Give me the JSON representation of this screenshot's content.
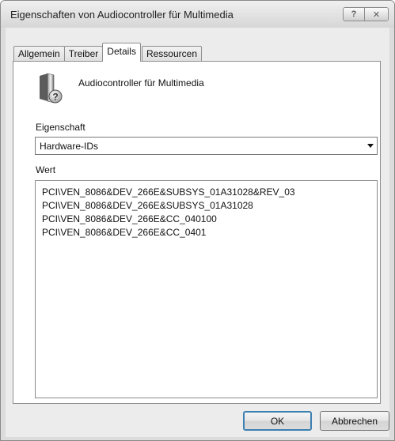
{
  "window": {
    "title": "Eigenschaften von Audiocontroller für Multimedia",
    "help_label": "?",
    "close_label": "✕"
  },
  "tabs": [
    {
      "label": "Allgemein",
      "active": false
    },
    {
      "label": "Treiber",
      "active": false
    },
    {
      "label": "Details",
      "active": true
    },
    {
      "label": "Ressourcen",
      "active": false
    }
  ],
  "device": {
    "name": "Audiocontroller für Multimedia",
    "icon": "speaker-question-icon"
  },
  "property": {
    "label": "Eigenschaft",
    "selected": "Hardware-IDs"
  },
  "value": {
    "label": "Wert",
    "items": [
      "PCI\\VEN_8086&DEV_266E&SUBSYS_01A31028&REV_03",
      "PCI\\VEN_8086&DEV_266E&SUBSYS_01A31028",
      "PCI\\VEN_8086&DEV_266E&CC_040100",
      "PCI\\VEN_8086&DEV_266E&CC_0401"
    ]
  },
  "buttons": {
    "ok": "OK",
    "cancel": "Abbrechen"
  }
}
